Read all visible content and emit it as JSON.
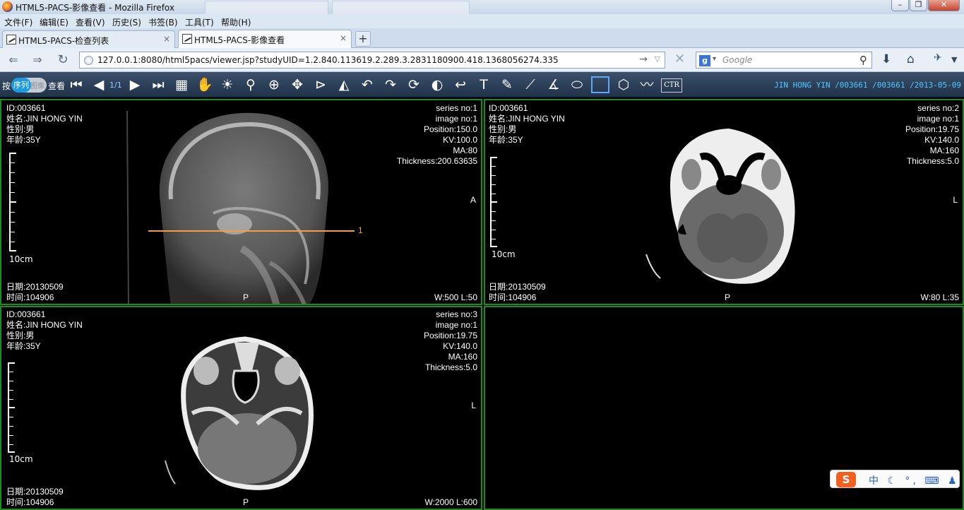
{
  "window": {
    "title": "HTML5-PACS-影像查看 - Mozilla Firefox"
  },
  "menu": [
    "文件(F)",
    "编辑(E)",
    "查看(V)",
    "历史(S)",
    "书签(B)",
    "工具(T)",
    "帮助(H)"
  ],
  "tabs": [
    {
      "label": "HTML5-PACS-检查列表",
      "close": "×",
      "active": false
    },
    {
      "label": "HTML5-PACS-影像查看",
      "close": "×",
      "active": true
    }
  ],
  "newtab": "+",
  "nav": {
    "url": "127.0.0.1:8080/html5pacs/viewer.jsp?studyUID=1.2.840.113619.2.289.3.2831180900.418.1368056274.335",
    "search_placeholder": "Google"
  },
  "toolbar": {
    "prefix": "按",
    "mode_on": "序列",
    "mode_off": "图像",
    "suffix": "查看",
    "page": "1/1",
    "ctr": "CTR",
    "patient": "JIN HONG YIN /003661 /003661 /2013-05-09"
  },
  "viewports": [
    {
      "tl": [
        "ID:003661",
        "姓名:JIN HONG YIN",
        "性别:男",
        "年龄:35Y"
      ],
      "tr": [
        "series no:1",
        "image no:1",
        "Position:150.0",
        "KV:100.0",
        "MA:80",
        "Thickness:200.63635"
      ],
      "right_marker": "A",
      "bottom_marker": "P",
      "bl": [
        "日期:20130509",
        "时间:104906"
      ],
      "br": "W:500 L:50",
      "scale_label": "10cm",
      "reference_line_label": "1"
    },
    {
      "tl": [
        "ID:003661",
        "姓名:JIN HONG YIN",
        "性别:男",
        "年龄:35Y"
      ],
      "tr": [
        "series no:2",
        "image no:1",
        "Position:19.75",
        "KV:140.0",
        "MA:160",
        "Thickness:5.0"
      ],
      "right_marker": "L",
      "bottom_marker": "P",
      "bl": [
        "日期:20130509",
        "时间:104906"
      ],
      "br": "W:80 L:35",
      "scale_label": "10cm"
    },
    {
      "tl": [
        "ID:003661",
        "姓名:JIN HONG YIN",
        "性别:男",
        "年龄:35Y"
      ],
      "tr": [
        "series no:3",
        "image no:1",
        "Position:19.75",
        "KV:140.0",
        "MA:160",
        "Thickness:5.0"
      ],
      "right_marker": "L",
      "bottom_marker": "P",
      "bl": [
        "日期:20130509",
        "时间:104906"
      ],
      "br": "W:2000 L:600",
      "scale_label": "10cm"
    }
  ],
  "ime": {
    "logo": "S",
    "items": "中 ☾ °, ⌨ ♟ ✎"
  },
  "colors": {
    "viewport_border": "#1c8d1c",
    "reference_line": "#f0a040",
    "toolbar_bg": "#2a3d55",
    "patient_info": "#51c8ff"
  }
}
